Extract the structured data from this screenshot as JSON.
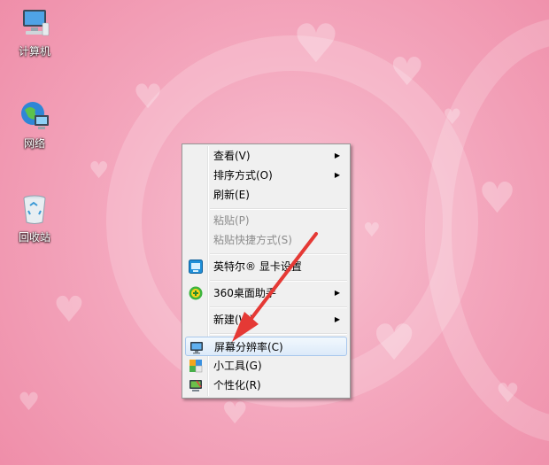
{
  "desktop": {
    "icons": [
      {
        "label": "计算机",
        "icon": "computer-icon"
      },
      {
        "label": "网络",
        "icon": "network-globe-icon"
      },
      {
        "label": "回收站",
        "icon": "recycle-bin-icon"
      }
    ]
  },
  "context_menu": {
    "items": [
      {
        "label": "查看(V)",
        "submenu": true
      },
      {
        "label": "排序方式(O)",
        "submenu": true
      },
      {
        "label": "刷新(E)"
      },
      {
        "label": "粘贴(P)",
        "disabled": true
      },
      {
        "label": "粘贴快捷方式(S)",
        "disabled": true
      },
      {
        "label": "英特尔® 显卡设置",
        "icon": "intel-graphics-icon"
      },
      {
        "label": "360桌面助手",
        "icon": "360-assistant-icon",
        "submenu": true
      },
      {
        "label": "新建(W)",
        "submenu": true
      },
      {
        "label": "屏幕分辨率(C)",
        "icon": "display-resolution-icon",
        "highlighted": true
      },
      {
        "label": "小工具(G)",
        "icon": "gadgets-icon"
      },
      {
        "label": "个性化(R)",
        "icon": "personalize-icon"
      }
    ],
    "submenu_glyph": "▶"
  },
  "colors": {
    "annotation_arrow": "#e53935",
    "highlight_border": "#a8c7ec"
  }
}
